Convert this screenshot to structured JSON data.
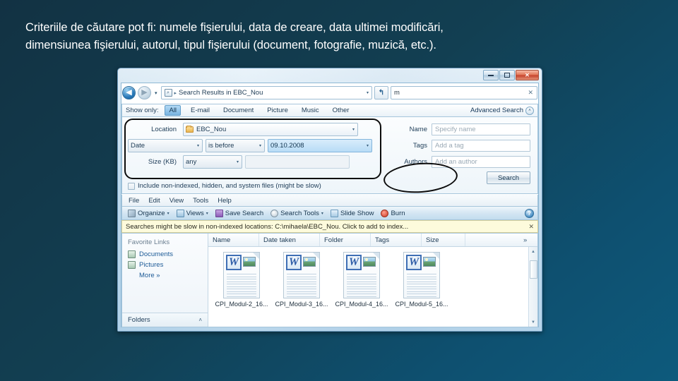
{
  "slide": {
    "heading": "Criteriile de căutare pot fi: numele fişierului, data de creare, data ultimei modificări,\ndimensiunea fişierului, autorul, tipul fişierului (document, fotografie, muzică, etc.)."
  },
  "window": {
    "buttons": {
      "minimize": "–",
      "maximize": "□",
      "close": "✕"
    },
    "navigation": {
      "back_icon": "back-arrow-icon",
      "forward_icon": "forward-arrow-icon",
      "history_chevron": "▾"
    },
    "address": {
      "icon": "search-folder-icon",
      "separator": "▸",
      "text": "Search Results in EBC_Nou",
      "dropdown": "▾"
    },
    "refresh_label": "↰",
    "search": {
      "value": "m",
      "clear": "✕"
    }
  },
  "filter_bar": {
    "label": "Show only:",
    "chips": [
      "All",
      "E-mail",
      "Document",
      "Picture",
      "Music",
      "Other"
    ],
    "active_chip": "All",
    "advanced_label": "Advanced Search",
    "advanced_chevron": "˄"
  },
  "advanced_search": {
    "left_rows": [
      {
        "label": "Location",
        "value": "EBC_Nou",
        "icon": "folder-icon"
      },
      {
        "label": "",
        "field": "Date",
        "operator": "is before",
        "value": "09.10.2008"
      },
      {
        "label": "Size (KB)",
        "field": "any",
        "value": ""
      }
    ],
    "labels": {
      "location": "Location",
      "date": "Date",
      "size": "Size (KB)"
    },
    "date_field": "Date",
    "date_operator": "is before",
    "date_value": "09.10.2008",
    "size_field": "any",
    "size_value": "",
    "include_checkbox_label": "Include non-indexed, hidden, and system files (might be slow)",
    "right_rows": [
      {
        "label": "Name",
        "placeholder": "Specify name"
      },
      {
        "label": "Tags",
        "placeholder": "Add a tag"
      },
      {
        "label": "Authors",
        "placeholder": "Add an author"
      }
    ],
    "search_button": "Search"
  },
  "menu_bar": [
    "File",
    "Edit",
    "View",
    "Tools",
    "Help"
  ],
  "toolbar": {
    "organize": "Organize",
    "views": "Views",
    "save_search": "Save Search",
    "search_tools": "Search Tools",
    "slide_show": "Slide Show",
    "burn": "Burn",
    "caret": "▾",
    "help": "?"
  },
  "notice": {
    "text": "Searches might be slow in non-indexed locations: C:\\mihaela\\EBC_Nou. Click to add to index...",
    "close": "✕"
  },
  "sidebar": {
    "title": "Favorite Links",
    "items": [
      {
        "label": "Documents",
        "icon": "documents-icon"
      },
      {
        "label": "Pictures",
        "icon": "pictures-icon"
      }
    ],
    "more": "More »",
    "folders": "Folders",
    "folders_chevron": "˄"
  },
  "file_list": {
    "columns": [
      "Name",
      "Date taken",
      "Folder",
      "Tags",
      "Size"
    ],
    "more_columns": "»",
    "items": [
      {
        "name": "CPI_Modul-2_16...",
        "badge": "W"
      },
      {
        "name": "CPI_Modul-3_16...",
        "badge": "W"
      },
      {
        "name": "CPI_Modul-4_16...",
        "badge": "W"
      },
      {
        "name": "CPI_Modul-5_16...",
        "badge": "W"
      }
    ],
    "scroll": {
      "up": "▲",
      "down": "▼"
    }
  },
  "colors": {
    "background_start": "#123243",
    "background_end": "#0d5a7c",
    "accent_blue": "#2878b8",
    "notice_yellow": "#fdfbdc",
    "annotation_ink": "#0c0c0c"
  }
}
